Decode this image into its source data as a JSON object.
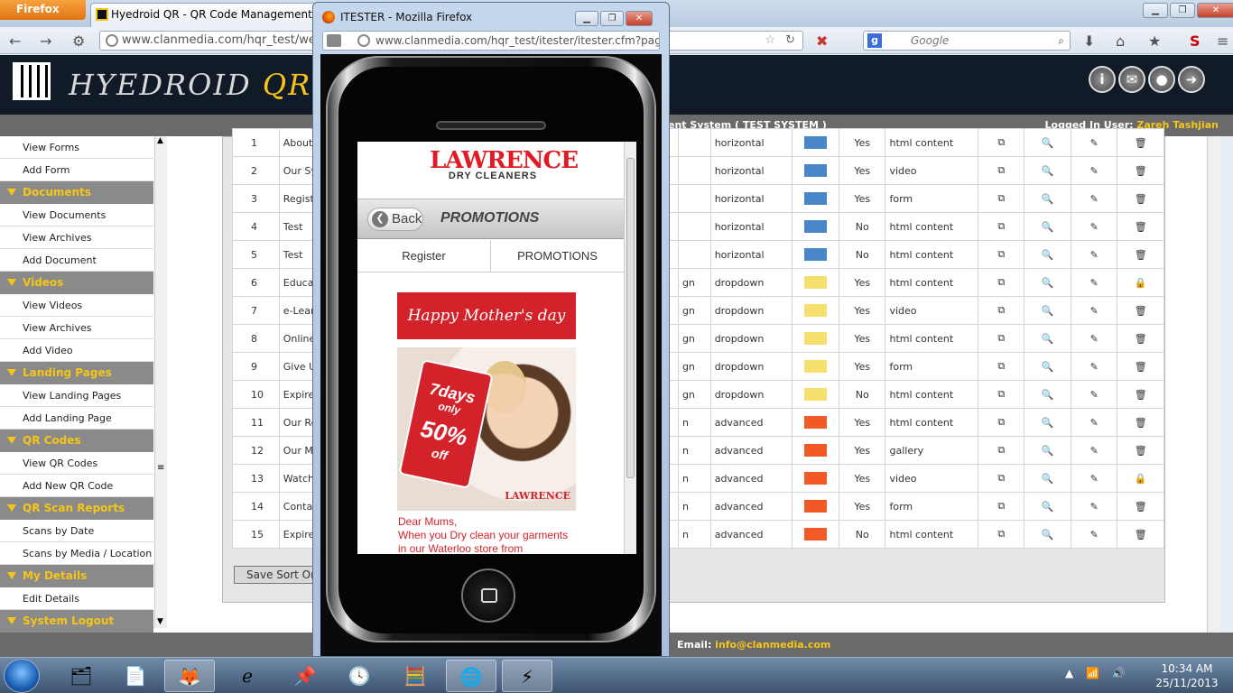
{
  "browser": {
    "firefox_button": "Firefox",
    "main_tab_title": "Hyedroid QR - QR Code Management S...",
    "main_url": "www.clanmedia.com/hqr_test/webadm",
    "search_placeholder": "Google"
  },
  "header": {
    "brand_part1": "HYEDROID ",
    "brand_part2": "QR",
    "system_title": "ent System ( TEST SYSTEM )",
    "logged_in_label": "Logged In User: ",
    "logged_in_user": "Zareh Tashjian"
  },
  "sidebar": [
    {
      "type": "item",
      "label": "View Forms"
    },
    {
      "type": "item",
      "label": "Add Form"
    },
    {
      "type": "section",
      "label": "Documents"
    },
    {
      "type": "item",
      "label": "View Documents"
    },
    {
      "type": "item",
      "label": "View Archives"
    },
    {
      "type": "item",
      "label": "Add Document"
    },
    {
      "type": "section",
      "label": "Videos"
    },
    {
      "type": "item",
      "label": "View Videos"
    },
    {
      "type": "item",
      "label": "View Archives"
    },
    {
      "type": "item",
      "label": "Add Video"
    },
    {
      "type": "section",
      "label": "Landing Pages"
    },
    {
      "type": "item",
      "label": "View Landing Pages"
    },
    {
      "type": "item",
      "label": "Add Landing Page"
    },
    {
      "type": "section",
      "label": "QR Codes"
    },
    {
      "type": "item",
      "label": "View QR Codes"
    },
    {
      "type": "item",
      "label": "Add New QR Code"
    },
    {
      "type": "section",
      "label": "QR Scan Reports"
    },
    {
      "type": "item",
      "label": "Scans by Date"
    },
    {
      "type": "item",
      "label": "Scans by Media / Location"
    },
    {
      "type": "section",
      "label": "My Details"
    },
    {
      "type": "item",
      "label": "Edit Details"
    },
    {
      "type": "section",
      "label": "System Logout"
    }
  ],
  "table_rows": [
    {
      "no": "1",
      "name": "About",
      "tail": "",
      "layout": "horizontal",
      "color": "#4a86c8",
      "active": "Yes",
      "type": "html content",
      "locked": false
    },
    {
      "no": "2",
      "name": "Our Sy",
      "tail": "",
      "layout": "horizontal",
      "color": "#4a86c8",
      "active": "Yes",
      "type": "video",
      "locked": false
    },
    {
      "no": "3",
      "name": "Regist",
      "tail": "",
      "layout": "horizontal",
      "color": "#4a86c8",
      "active": "Yes",
      "type": "form",
      "locked": false
    },
    {
      "no": "4",
      "name": "Test",
      "tail": "",
      "layout": "horizontal",
      "color": "#4a86c8",
      "active": "No",
      "type": "html content",
      "locked": false
    },
    {
      "no": "5",
      "name": "Test",
      "tail": "",
      "layout": "horizontal",
      "color": "#4a86c8",
      "active": "No",
      "type": "html content",
      "locked": false
    },
    {
      "no": "6",
      "name": "Educat",
      "tail": "gn",
      "layout": "dropdown",
      "color": "#f7df6e",
      "active": "Yes",
      "type": "html content",
      "locked": true
    },
    {
      "no": "7",
      "name": "e-Lear",
      "tail": "gn",
      "layout": "dropdown",
      "color": "#f7df6e",
      "active": "Yes",
      "type": "video",
      "locked": false
    },
    {
      "no": "8",
      "name": "Online",
      "tail": "gn",
      "layout": "dropdown",
      "color": "#f7df6e",
      "active": "Yes",
      "type": "html content",
      "locked": false
    },
    {
      "no": "9",
      "name": "Give U",
      "tail": "gn",
      "layout": "dropdown",
      "color": "#f7df6e",
      "active": "Yes",
      "type": "form",
      "locked": false
    },
    {
      "no": "10",
      "name": "Expire",
      "tail": "gn",
      "layout": "dropdown",
      "color": "#f7df6e",
      "active": "No",
      "type": "html content",
      "locked": false
    },
    {
      "no": "11",
      "name": "Our Re",
      "tail": "n",
      "layout": "advanced",
      "color": "#f15a24",
      "active": "Yes",
      "type": "html content",
      "locked": false
    },
    {
      "no": "12",
      "name": "Our Me",
      "tail": "n",
      "layout": "advanced",
      "color": "#f15a24",
      "active": "Yes",
      "type": "gallery",
      "locked": false
    },
    {
      "no": "13",
      "name": "Watch",
      "tail": "n",
      "layout": "advanced",
      "color": "#f15a24",
      "active": "Yes",
      "type": "video",
      "locked": true
    },
    {
      "no": "14",
      "name": "Conta",
      "tail": "n",
      "layout": "advanced",
      "color": "#f15a24",
      "active": "Yes",
      "type": "form",
      "locked": false
    },
    {
      "no": "15",
      "name": "Expire",
      "tail": "n",
      "layout": "advanced",
      "color": "#f15a24",
      "active": "No",
      "type": "html content",
      "locked": false
    }
  ],
  "save_sort_label": "Save Sort Or",
  "footer": {
    "email_label": "Email: ",
    "email": "info@clanmedia.com"
  },
  "popup": {
    "title": "ITESTER - Mozilla Firefox",
    "url": "www.clanmedia.com/hqr_test/itester/itester.cfm?page",
    "logo_big": "LAWRENCE",
    "logo_small": "DRY CLEANERS",
    "back_label": "Back",
    "screen_title": "PROMOTIONS",
    "tab_register": "Register",
    "tab_promotions": "PROMOTIONS",
    "banner": "Happy Mother's day",
    "tag_days": "7days",
    "tag_only": "only",
    "tag_percent": "50%",
    "tag_off": "off",
    "photo_logo": "LAWRENCE",
    "text_line1": "Dear Mums,",
    "text_line2": "When you Dry clean your garments",
    "text_line3": "in our Waterloo store from"
  },
  "taskbar": {
    "time": "10:34 AM",
    "date": "25/11/2013"
  },
  "colors": {
    "accent": "#f5c518",
    "header_bg": "#101b27",
    "bar_gray": "#6a6a6a",
    "yes_red": "#d00000"
  }
}
